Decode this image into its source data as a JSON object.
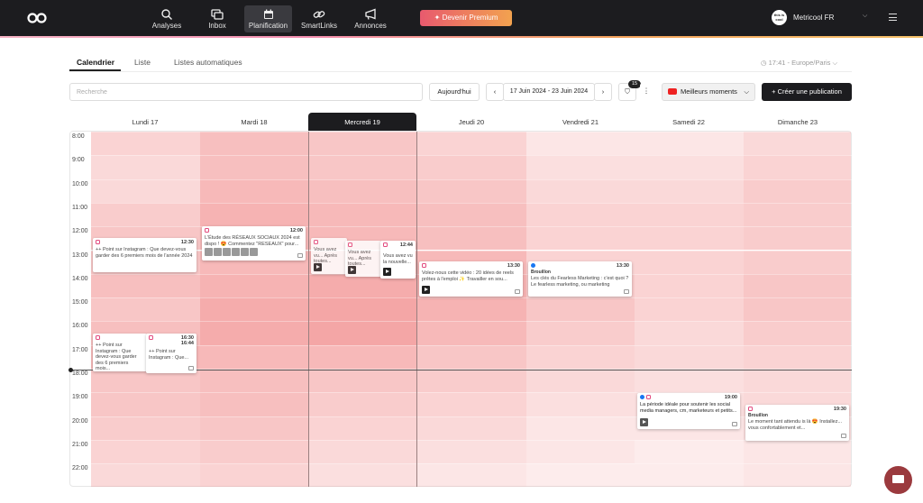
{
  "nav": {
    "items": [
      {
        "label": "Analyses",
        "icon": "analytics-icon"
      },
      {
        "label": "Inbox",
        "icon": "inbox-icon"
      },
      {
        "label": "Planification",
        "icon": "calendar-icon",
        "active": true
      },
      {
        "label": "SmartLinks",
        "icon": "link-icon"
      },
      {
        "label": "Annonces",
        "icon": "megaphone-icon"
      }
    ],
    "premium_label": "Devenir Premium",
    "account_avatar": "this is cool",
    "account_name": "Metricool FR"
  },
  "tabs": [
    "Calendrier",
    "Liste",
    "Listes automatiques"
  ],
  "timezone": "17:41 - Europe/Paris",
  "toolbar": {
    "search_placeholder": "Recherche",
    "today_label": "Aujourd'hui",
    "date_range": "17 Juin 2024 - 23 Juin 2024",
    "filter_count": "15",
    "best_moments_label": "Meilleurs moments",
    "create_label": "Créer une publication"
  },
  "days": [
    "Lundi 17",
    "Mardi 18",
    "Mercredi 19",
    "Jeudi 20",
    "Vendredi 21",
    "Samedi 22",
    "Dimanche 23"
  ],
  "hours": [
    "8:00",
    "9:00",
    "10:00",
    "11:00",
    "12:00",
    "13:00",
    "14:00",
    "15:00",
    "16:00",
    "17:00",
    "18:00",
    "19:00",
    "20:00",
    "21:00",
    "22:00"
  ],
  "heat": [
    [
      0.35,
      0.3,
      0.3,
      0.4,
      0.45,
      0.45,
      0.5,
      0.45,
      0.5,
      0.55,
      0.45,
      0.45,
      0.4,
      0.35,
      0.3
    ],
    [
      0.5,
      0.5,
      0.55,
      0.6,
      0.55,
      0.55,
      0.6,
      0.65,
      0.65,
      0.55,
      0.5,
      0.5,
      0.45,
      0.4,
      0.35
    ],
    [
      0.45,
      0.45,
      0.5,
      0.55,
      0.55,
      0.6,
      0.65,
      0.7,
      0.7,
      0.55,
      0.45,
      0.4,
      0.35,
      0.3,
      0.25
    ],
    [
      0.35,
      0.4,
      0.45,
      0.5,
      0.5,
      0.55,
      0.6,
      0.6,
      0.55,
      0.45,
      0.4,
      0.35,
      0.3,
      0.25,
      0.2
    ],
    [
      0.2,
      0.25,
      0.3,
      0.35,
      0.35,
      0.35,
      0.4,
      0.45,
      0.4,
      0.35,
      0.3,
      0.25,
      0.2,
      0.2,
      0.15
    ],
    [
      0.2,
      0.25,
      0.3,
      0.35,
      0.35,
      0.35,
      0.35,
      0.35,
      0.3,
      0.3,
      0.25,
      0.25,
      0.2,
      0.15,
      0.15
    ],
    [
      0.3,
      0.35,
      0.4,
      0.4,
      0.4,
      0.4,
      0.45,
      0.45,
      0.4,
      0.35,
      0.3,
      0.3,
      0.25,
      0.2,
      0.2
    ]
  ],
  "posts": [
    {
      "time": "12:30",
      "text": "++ Point sur Instagram : Que devez-vous garder des 6 premiers mois de l'année 2024",
      "network": "instagram"
    },
    {
      "time": "12:00",
      "text": "L'Étude des RÉSEAUX SOCIAUX 2024 est dispo ! 😍 Commentez \"RESEAUX\" pour...",
      "network": "instagram"
    },
    {
      "time": "",
      "text": "Vous avez vu... Après toutes...",
      "network": "instagram"
    },
    {
      "time": "",
      "text": "Vous avez vu... Après toutes...",
      "network": "instagram"
    },
    {
      "time": "12:44",
      "text": "Vous avez vu la nouvelle...",
      "network": "instagram"
    },
    {
      "time": "13:30",
      "text": "Volez-nous cette vidéo : 20 idées de reels prêtes à l'emploi ✨ Travailler en sou...",
      "network": "instagram"
    },
    {
      "time": "13:30",
      "draft": "Brouillon",
      "text": "Les clés du Fearless Marketing : c'est quoi ? Le fearless marketing, ou marketing",
      "network": "facebook"
    },
    {
      "time": "16:30",
      "text": "++ Point sur Instagram : Que devez-vous garder des 6 premiers mois...",
      "network": "instagram"
    },
    {
      "time": "16:44",
      "text": "++ Point sur Instagram : Que...",
      "network": "instagram"
    },
    {
      "time": "19:00",
      "text": "La période idéale pour soutenir les social media managers, cm, marketeurs et petits...",
      "network": "facebook"
    },
    {
      "time": "19:30",
      "draft": "Brouillon",
      "text": "Le moment tant attendu is là 😍 Installez... vous confortablement et...",
      "network": "instagram"
    }
  ],
  "colors": {
    "heat": "#f08080",
    "accent": "#1c1c1f",
    "premium_from": "#e85a6e",
    "premium_to": "#f2a24f"
  }
}
